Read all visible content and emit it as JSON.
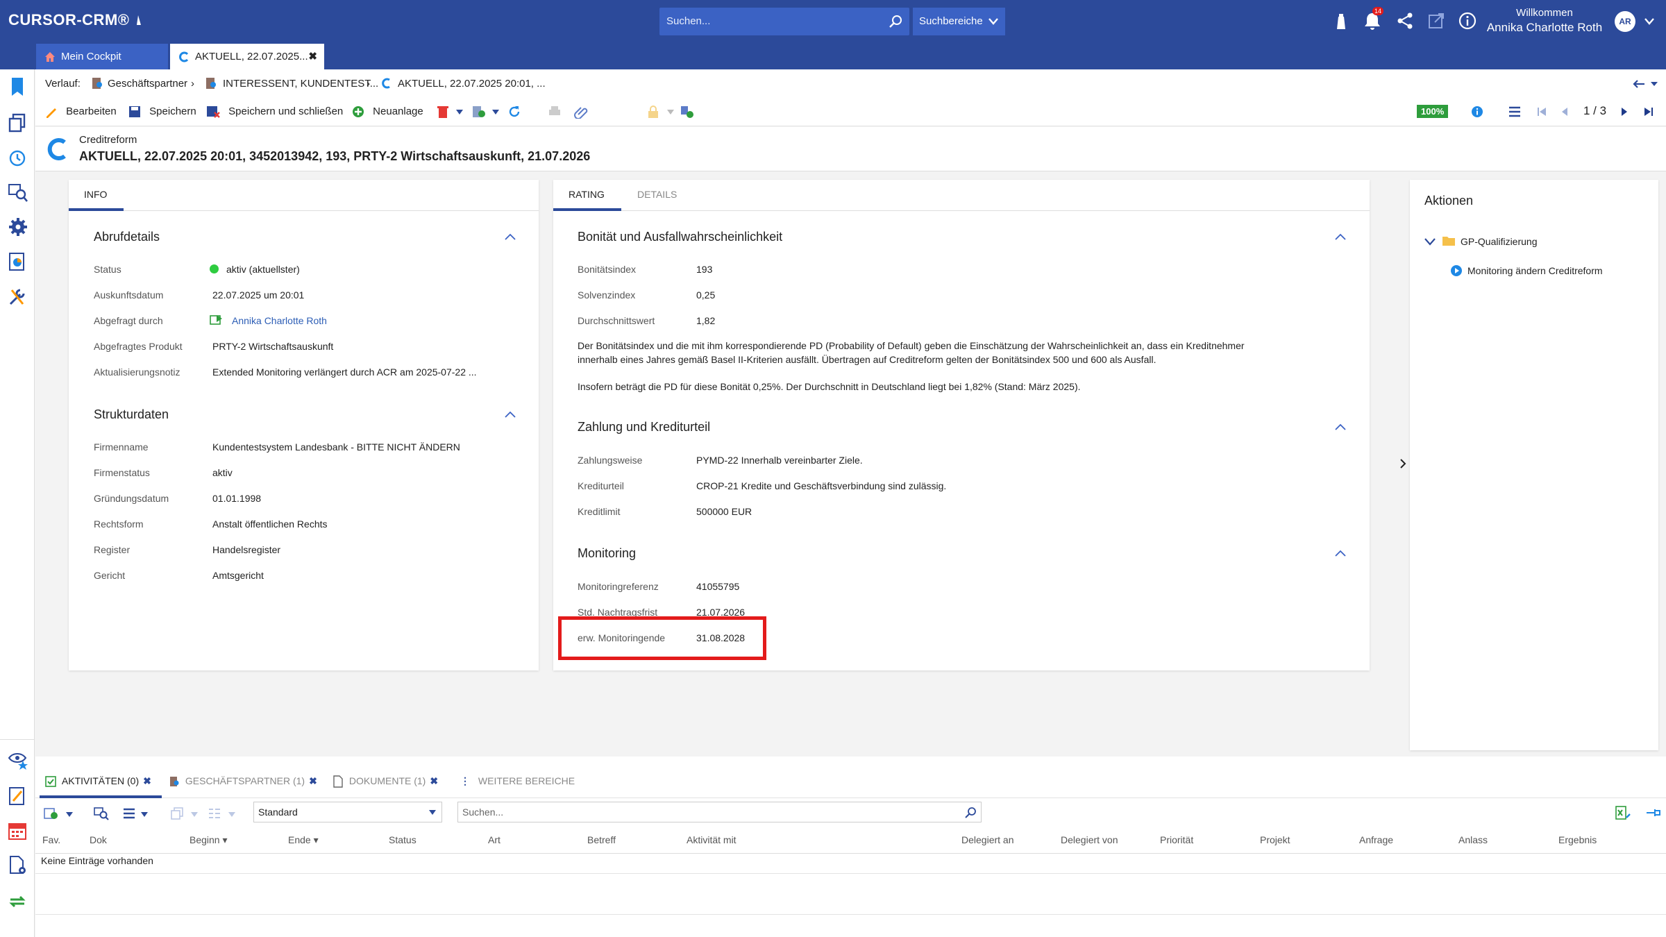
{
  "app": {
    "logo": "CURSOR-CRM®"
  },
  "header": {
    "search_placeholder": "Suchen...",
    "search_areas": "Suchbereiche",
    "notification_count": "14",
    "welcome": "Willkommen",
    "user_name": "Annika Charlotte Roth",
    "user_initials": "AR",
    "icons": [
      "lighthouse-icon",
      "bell-icon",
      "share-icon",
      "external-link-icon",
      "info-icon",
      "chevron-down-icon"
    ]
  },
  "tabs": [
    {
      "label": "Mein Cockpit",
      "icon": "home-icon"
    },
    {
      "label": "AKTUELL, 22.07.2025...",
      "icon": "creditreform-icon",
      "close": "✖"
    }
  ],
  "breadcrumb": {
    "label": "Verlauf:",
    "items": [
      "Geschäftspartner",
      "INTERESSENT, KUNDENTEST...",
      "AKTUELL, 22.07.2025 20:01, ..."
    ]
  },
  "toolbar": {
    "edit": "Bearbeiten",
    "save": "Speichern",
    "save_close": "Speichern und schließen",
    "new": "Neuanlage",
    "zoom": "100%",
    "pager": "1 / 3"
  },
  "record": {
    "type": "Creditreform",
    "title": "AKTUELL, 22.07.2025 20:01, 3452013942, 193, PRTY-2 Wirtschaftsauskunft, 21.07.2026"
  },
  "left_panel": {
    "tab": "INFO",
    "abruf": {
      "title": "Abrufdetails",
      "rows": [
        {
          "label": "Status",
          "value": "aktiv (aktuellster)",
          "status_color": "#2ecc40"
        },
        {
          "label": "Auskunftsdatum",
          "value": "22.07.2025 um 20:01"
        },
        {
          "label": "Abgefragt durch",
          "value": "Annika Charlotte Roth"
        },
        {
          "label": "Abgefragtes Produkt",
          "value": "PRTY-2 Wirtschaftsauskunft"
        },
        {
          "label": "Aktualisierungsnotiz",
          "value": "Extended Monitoring verlängert durch ACR am 2025-07-22 ..."
        }
      ]
    },
    "struktur": {
      "title": "Strukturdaten",
      "rows": [
        {
          "label": "Firmenname",
          "value": "Kundentestsystem Landesbank - BITTE NICHT ÄNDERN"
        },
        {
          "label": "Firmenstatus",
          "value": "aktiv"
        },
        {
          "label": "Gründungsdatum",
          "value": "01.01.1998"
        },
        {
          "label": "Rechtsform",
          "value": "Anstalt öffentlichen Rechts"
        },
        {
          "label": "Register",
          "value": "Handelsregister"
        },
        {
          "label": "Gericht",
          "value": "Amtsgericht"
        }
      ]
    }
  },
  "mid_panel": {
    "tabs": [
      "RATING",
      "DETAILS"
    ],
    "bonitaet": {
      "title": "Bonität und Ausfallwahrscheinlichkeit",
      "rows": [
        {
          "label": "Bonitätsindex",
          "value": "193"
        },
        {
          "label": "Solvenzindex",
          "value": "0,25"
        },
        {
          "label": "Durchschnittswert",
          "value": "1,82"
        }
      ],
      "text1a": "Der Bonitätsindex und die mit ihm korrespondierende PD (Probability of Default) geben die Einschätzung der Wahrscheinlichkeit an, dass ein Kreditnehmer",
      "text1b": "innerhalb eines Jahres gemäß Basel II-Kriterien ausfällt. Übertragen auf Creditreform gelten der Bonitätsindex 500 und 600 als Ausfall.",
      "text2": "Insofern beträgt die PD für diese Bonität 0,25%. Der Durchschnitt in Deutschland liegt bei 1,82% (Stand: März 2025)."
    },
    "zahlung": {
      "title": "Zahlung und Krediturteil",
      "rows": [
        {
          "label": "Zahlungsweise",
          "value": "PYMD-22 Innerhalb vereinbarter Ziele."
        },
        {
          "label": "Krediturteil",
          "value": "CROP-21 Kredite und Geschäftsverbindung sind zulässig."
        },
        {
          "label": "Kreditlimit",
          "value": "500000 EUR"
        }
      ]
    },
    "monitoring": {
      "title": "Monitoring",
      "rows": [
        {
          "label": "Monitoringreferenz",
          "value": "41055795"
        },
        {
          "label": "Std. Nachtragsfrist",
          "value": "21.07.2026"
        },
        {
          "label": "erw. Monitoringende",
          "value": "31.08.2028"
        }
      ]
    }
  },
  "actions": {
    "title": "Aktionen",
    "folder": "GP-Qualifizierung",
    "item": "Monitoring ändern Creditreform"
  },
  "bottom": {
    "tabs": [
      {
        "label": "AKTIVITÄTEN (0)",
        "close": "✖"
      },
      {
        "label": "GESCHÄFTSPARTNER (1)",
        "close": "✖"
      },
      {
        "label": "DOKUMENTE (1)",
        "close": "✖"
      },
      {
        "label": "WEITERE BEREICHE"
      }
    ],
    "view_select": "Standard",
    "search_placeholder": "Suchen...",
    "columns": [
      "Fav.",
      "Dok",
      "Beginn",
      "Ende",
      "Status",
      "Art",
      "Betreff",
      "Aktivität mit",
      "Delegiert an",
      "Delegiert von",
      "Priorität",
      "Projekt",
      "Anfrage",
      "Anlass",
      "Ergebnis"
    ],
    "empty": "Keine Einträge vorhanden"
  },
  "colors": {
    "brand": "#2c4a9a",
    "tab_active": "#3b62c4",
    "highlight": "#e31b1b",
    "status_ok": "#2ecc40",
    "zoom_badge": "#2e9d3c"
  }
}
